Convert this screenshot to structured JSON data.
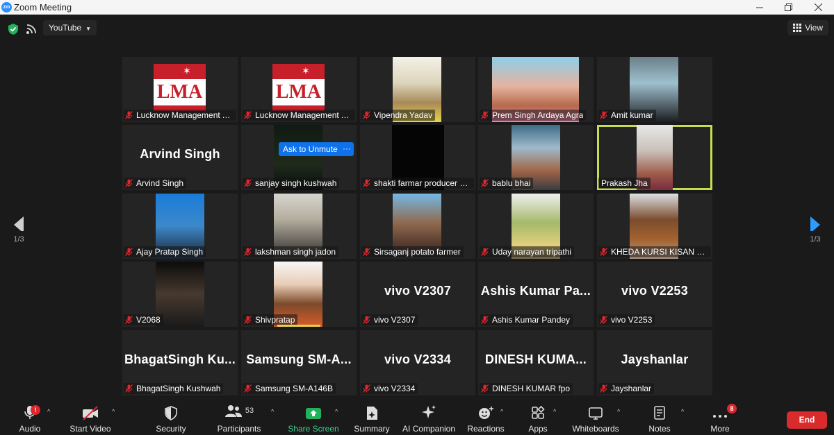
{
  "window": {
    "title": "Zoom Meeting",
    "logo_text": "zm",
    "controls": [
      "minimize",
      "maximize",
      "close"
    ]
  },
  "topbar": {
    "share_source": "YouTube",
    "view_label": "View"
  },
  "pagination": {
    "left": "1/3",
    "right": "1/3"
  },
  "participants": [
    {
      "label": "Lucknow Management A...",
      "kind": "logo",
      "logo_text": "LMA"
    },
    {
      "label": "Lucknow Management Asso...",
      "kind": "logo",
      "logo_text": "LMA"
    },
    {
      "label": "Vipendra Yadav",
      "kind": "video"
    },
    {
      "label": "Prem Singh Ardaya Agra",
      "kind": "video"
    },
    {
      "label": "Amit kumar",
      "kind": "video"
    },
    {
      "label": "Arvind Singh",
      "kind": "name",
      "display": "Arvind Singh"
    },
    {
      "label": "sanjay singh kushwah",
      "kind": "video"
    },
    {
      "label": "shakti farmar producer C...",
      "kind": "video"
    },
    {
      "label": "bablu bhai",
      "kind": "video"
    },
    {
      "label": "Prakash Jha",
      "kind": "video",
      "active": true
    },
    {
      "label": "Ajay Pratap Singh",
      "kind": "video"
    },
    {
      "label": "lakshman singh jadon",
      "kind": "video"
    },
    {
      "label": "Sirsaganj potato farmer",
      "kind": "video"
    },
    {
      "label": "Uday narayan tripathi",
      "kind": "video"
    },
    {
      "label": "KHEDA KURSI KISAN UTP...",
      "kind": "video"
    },
    {
      "label": "V2068",
      "kind": "video"
    },
    {
      "label": "Shivpratap",
      "kind": "video"
    },
    {
      "label": "vivo V2307",
      "kind": "name",
      "display": "vivo V2307"
    },
    {
      "label": "Ashis Kumar Pandey",
      "kind": "name",
      "display": "Ashis Kumar Pa..."
    },
    {
      "label": "vivo V2253",
      "kind": "name",
      "display": "vivo V2253"
    },
    {
      "label": "BhagatSingh Kushwah",
      "kind": "name",
      "display": "BhagatSingh Ku..."
    },
    {
      "label": "Samsung SM-A146B",
      "kind": "name",
      "display": "Samsung SM-A..."
    },
    {
      "label": "vivo V2334",
      "kind": "name",
      "display": "vivo V2334"
    },
    {
      "label": "DINESH KUMAR fpo",
      "kind": "name",
      "display": "DINESH KUMA..."
    },
    {
      "label": "Jayshanlar",
      "kind": "name",
      "display": "Jayshanlar"
    }
  ],
  "hover": {
    "ask_unmute": "Ask to Unmute",
    "more": "···"
  },
  "toolbar": {
    "audio": "Audio",
    "audio_badge": "!",
    "start_video": "Start Video",
    "security": "Security",
    "participants": "Participants",
    "participants_count": "53",
    "share_screen": "Share Screen",
    "summary": "Summary",
    "ai_companion": "AI Companion",
    "reactions": "Reactions",
    "apps": "Apps",
    "whiteboards": "Whiteboards",
    "notes": "Notes",
    "more": "More",
    "more_badge": "8",
    "end": "End"
  },
  "colors": {
    "accent_blue": "#0e72ed",
    "share_green": "#3ecf8e",
    "end_red": "#d92b2b",
    "active_speaker": "#c8dc50",
    "mute_red": "#e0262e"
  }
}
